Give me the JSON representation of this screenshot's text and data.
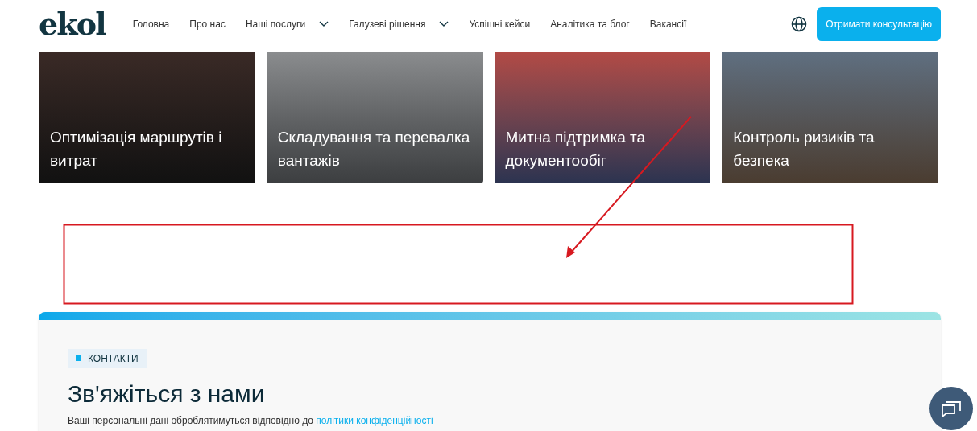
{
  "header": {
    "logo": "ekol",
    "nav": [
      {
        "label": "Головна",
        "has_dropdown": false
      },
      {
        "label": "Про нас",
        "has_dropdown": false
      },
      {
        "label": "Наші послуги",
        "has_dropdown": true
      },
      {
        "label": "Галузеві рішення",
        "has_dropdown": true
      },
      {
        "label": "Успішні кейси",
        "has_dropdown": false
      },
      {
        "label": "Аналітика та блог",
        "has_dropdown": false
      },
      {
        "label": "Вакансії",
        "has_dropdown": false
      }
    ],
    "cta": "Отримати консультацію"
  },
  "cards": [
    {
      "title": "Оптимізація маршрутів і витрат"
    },
    {
      "title": "Складування та перевалка вантажів"
    },
    {
      "title": "Митна підтримка та документообіг"
    },
    {
      "title": "Контроль ризиків та безпека"
    }
  ],
  "contacts": {
    "tag": "КОНТАКТИ",
    "heading": "Зв'яжіться з нами",
    "note": "Ваші персональні дані оброблятимуться відповідно до",
    "link": "політики конфіденційності"
  }
}
